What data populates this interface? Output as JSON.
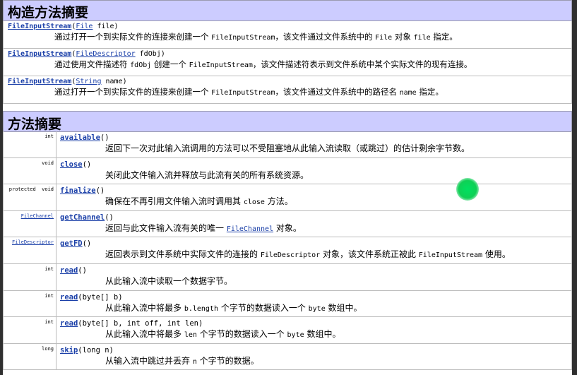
{
  "constructor_summary": {
    "title": "构造方法摘要",
    "rows": [
      {
        "name": "FileInputStream",
        "param_type": "File",
        "param_rest": " file)",
        "desc_parts": [
          {
            "t": "通过打开一个到实际文件的连接来创建一个 ",
            "m": false
          },
          {
            "t": "FileInputStream",
            "m": true
          },
          {
            "t": "，该文件通过文件系统中的 ",
            "m": false
          },
          {
            "t": "File",
            "m": true
          },
          {
            "t": " 对象 ",
            "m": false
          },
          {
            "t": "file",
            "m": true
          },
          {
            "t": " 指定。",
            "m": false
          }
        ]
      },
      {
        "name": "FileInputStream",
        "param_type": "FileDescriptor",
        "param_rest": " fdObj)",
        "desc_parts": [
          {
            "t": "通过使用文件描述符 ",
            "m": false
          },
          {
            "t": "fdObj",
            "m": true
          },
          {
            "t": " 创建一个 ",
            "m": false
          },
          {
            "t": "FileInputStream",
            "m": true
          },
          {
            "t": "，该文件描述符表示到文件系统中某个实际文件的现有连接。",
            "m": false
          }
        ]
      },
      {
        "name": "FileInputStream",
        "param_type": "String",
        "param_rest": " name)",
        "desc_parts": [
          {
            "t": "通过打开一个到实际文件的连接来创建一个 ",
            "m": false
          },
          {
            "t": "FileInputStream",
            "m": true
          },
          {
            "t": "，该文件通过文件系统中的路径名 ",
            "m": false
          },
          {
            "t": "name",
            "m": true
          },
          {
            "t": " 指定。",
            "m": false
          }
        ]
      }
    ]
  },
  "method_summary": {
    "title": "方法摘要",
    "rows": [
      {
        "modifier": "int",
        "type_link": "",
        "name": "available",
        "params": "()",
        "desc_parts": [
          {
            "t": "返回下一次对此输入流调用的方法可以不受阻塞地从此输入流读取（或跳过）的估计剩余字节数。",
            "m": false
          }
        ]
      },
      {
        "modifier": "void",
        "type_link": "",
        "name": "close",
        "params": "()",
        "desc_parts": [
          {
            "t": "关闭此文件输入流并释放与此流有关的所有系统资源。",
            "m": false
          }
        ]
      },
      {
        "modifier": "protected  void",
        "type_link": "",
        "name": "finalize",
        "params": "()",
        "desc_parts": [
          {
            "t": "确保在不再引用文件输入流时调用其 ",
            "m": false
          },
          {
            "t": "close",
            "m": true
          },
          {
            "t": " 方法。",
            "m": false
          }
        ]
      },
      {
        "modifier": "",
        "type_link": "FileChannel",
        "name": "getChannel",
        "params": "()",
        "desc_parts": [
          {
            "t": "返回与此文件输入流有关的唯一 ",
            "m": false
          },
          {
            "t": "FileChannel",
            "m": true,
            "link": true
          },
          {
            "t": " 对象。",
            "m": false
          }
        ]
      },
      {
        "modifier": "",
        "type_link": "FileDescriptor",
        "name": "getFD",
        "params": "()",
        "desc_parts": [
          {
            "t": "返回表示到文件系统中实际文件的连接的 ",
            "m": false
          },
          {
            "t": "FileDescriptor",
            "m": true
          },
          {
            "t": " 对象，该文件系统正被此 ",
            "m": false
          },
          {
            "t": "FileInputStream",
            "m": true
          },
          {
            "t": " 使用。",
            "m": false
          }
        ]
      },
      {
        "modifier": "int",
        "type_link": "",
        "name": "read",
        "params": "()",
        "desc_parts": [
          {
            "t": "从此输入流中读取一个数据字节。",
            "m": false
          }
        ]
      },
      {
        "modifier": "int",
        "type_link": "",
        "name": "read",
        "params": "(byte[] b)",
        "desc_parts": [
          {
            "t": "从此输入流中将最多 ",
            "m": false
          },
          {
            "t": "b.length",
            "m": true
          },
          {
            "t": " 个字节的数据读入一个 ",
            "m": false
          },
          {
            "t": "byte",
            "m": true
          },
          {
            "t": " 数组中。",
            "m": false
          }
        ]
      },
      {
        "modifier": "int",
        "type_link": "",
        "name": "read",
        "params": "(byte[] b, int off, int len)",
        "desc_parts": [
          {
            "t": "从此输入流中将最多 ",
            "m": false
          },
          {
            "t": "len",
            "m": true
          },
          {
            "t": " 个字节的数据读入一个 ",
            "m": false
          },
          {
            "t": "byte",
            "m": true
          },
          {
            "t": " 数组中。",
            "m": false
          }
        ]
      },
      {
        "modifier": "long",
        "type_link": "",
        "name": "skip",
        "params": "(long n)",
        "desc_parts": [
          {
            "t": "从输入流中跳过并丢弃 ",
            "m": false
          },
          {
            "t": "n",
            "m": true
          },
          {
            "t": " 个字节的数据。",
            "m": false
          }
        ]
      }
    ]
  },
  "colors": {
    "header_bg": "#ccccff",
    "link": "#1a3fa8",
    "cursor_highlight": "#00e060"
  }
}
